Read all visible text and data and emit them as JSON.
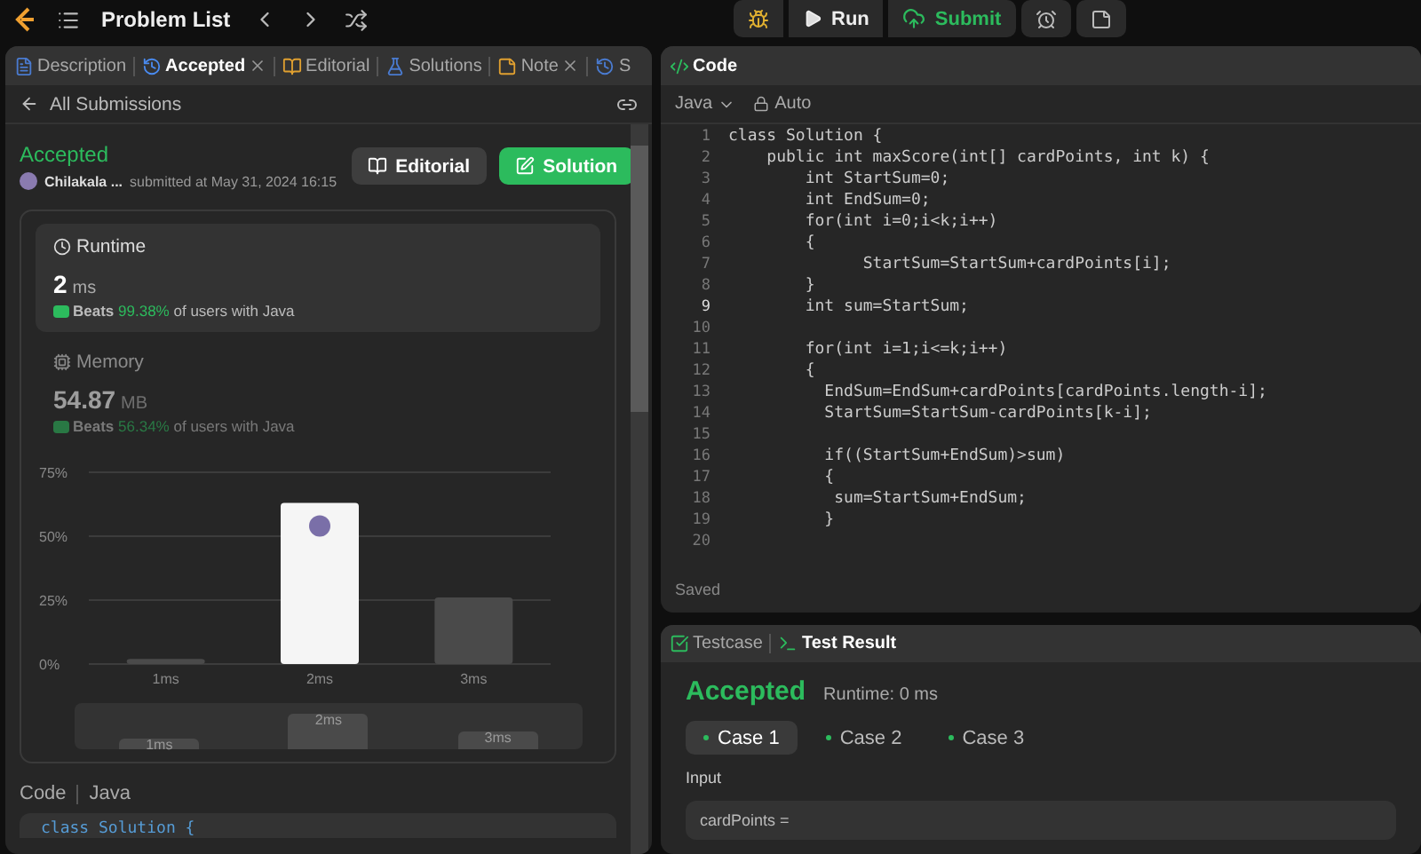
{
  "topbar": {
    "title": "Problem List",
    "run": "Run",
    "submit": "Submit"
  },
  "left_tabs": [
    {
      "label": "Description",
      "selected": false,
      "closable": false
    },
    {
      "label": "Accepted",
      "selected": true,
      "closable": true
    },
    {
      "label": "Editorial",
      "selected": false,
      "closable": false
    },
    {
      "label": "Solutions",
      "selected": false,
      "closable": false
    },
    {
      "label": "Note",
      "selected": false,
      "closable": true
    },
    {
      "label": "S",
      "selected": false,
      "closable": false
    }
  ],
  "back_link": "All Submissions",
  "submission": {
    "status": "Accepted",
    "user": "Chilakala ...",
    "submitted": "submitted at May 31, 2024 16:15",
    "editorial_button": "Editorial",
    "solution_button": "Solution"
  },
  "stats": [
    {
      "title": "Runtime",
      "value": "2",
      "unit": "ms",
      "beats_label": "Beats",
      "beats": "99.38%",
      "suffix": "of users with Java",
      "selected": true
    },
    {
      "title": "Memory",
      "value": "54.87",
      "unit": "MB",
      "beats_label": "Beats",
      "beats": "56.34%",
      "suffix": "of users with Java",
      "selected": false
    }
  ],
  "distribution": {
    "chart_data": {
      "type": "bar",
      "categories": [
        "1ms",
        "2ms",
        "3ms"
      ],
      "values": [
        2,
        63,
        26
      ],
      "ylim": [
        0,
        75
      ],
      "yticks": [
        {
          "value": 0,
          "label": "0%"
        },
        {
          "value": 25,
          "label": "25%"
        },
        {
          "value": 50,
          "label": "50%"
        },
        {
          "value": 75,
          "label": "75%"
        }
      ]
    },
    "overview_labels": [
      "1ms",
      "2ms",
      "3ms"
    ]
  },
  "code_section": {
    "label": "Code",
    "language": "Java",
    "first_line": "class Solution {"
  },
  "editor": {
    "title": "Code",
    "language": "Java",
    "mode": "Auto",
    "status": "Saved",
    "lines": [
      {
        "n": "1",
        "text": "class Solution {",
        "current": false
      },
      {
        "n": "2",
        "text": "    public int maxScore(int[] cardPoints, int k) {",
        "current": false
      },
      {
        "n": "3",
        "text": "        int StartSum=0;",
        "current": false
      },
      {
        "n": "4",
        "text": "        int EndSum=0;",
        "current": false
      },
      {
        "n": "5",
        "text": "        for(int i=0;i<k;i++)",
        "current": false
      },
      {
        "n": "6",
        "text": "        {",
        "current": false
      },
      {
        "n": "7",
        "text": "              StartSum=StartSum+cardPoints[i];",
        "current": false
      },
      {
        "n": "8",
        "text": "        }",
        "current": false
      },
      {
        "n": "9",
        "text": "        int sum=StartSum;",
        "current": true
      },
      {
        "n": "10",
        "current": false
      },
      {
        "n": "11",
        "text": "        for(int i=1;i<=k;i++)",
        "current": false
      },
      {
        "n": "12",
        "text": "        {",
        "current": false
      },
      {
        "n": "13",
        "text": "          EndSum=EndSum+cardPoints[cardPoints.length-i];",
        "current": false
      },
      {
        "n": "14",
        "text": "          StartSum=StartSum-cardPoints[k-i];",
        "current": false
      },
      {
        "n": "15",
        "current": false
      },
      {
        "n": "16",
        "text": "          if((StartSum+EndSum)>sum)",
        "current": false
      },
      {
        "n": "17",
        "text": "          {",
        "current": false
      },
      {
        "n": "18",
        "text": "           sum=StartSum+EndSum;",
        "current": false
      },
      {
        "n": "19",
        "text": "          }",
        "current": false
      },
      {
        "n": "20",
        "current": false
      }
    ]
  },
  "bottom_tabs": [
    {
      "label": "Testcase",
      "selected": false
    },
    {
      "label": "Test Result",
      "selected": true
    }
  ],
  "result": {
    "status": "Accepted",
    "runtime": "Runtime: 0 ms",
    "cases": [
      {
        "label": "Case 1",
        "selected": true
      },
      {
        "label": "Case 2",
        "selected": false
      },
      {
        "label": "Case 3",
        "selected": false
      }
    ],
    "input_label": "Input",
    "input_value": "cardPoints ="
  }
}
